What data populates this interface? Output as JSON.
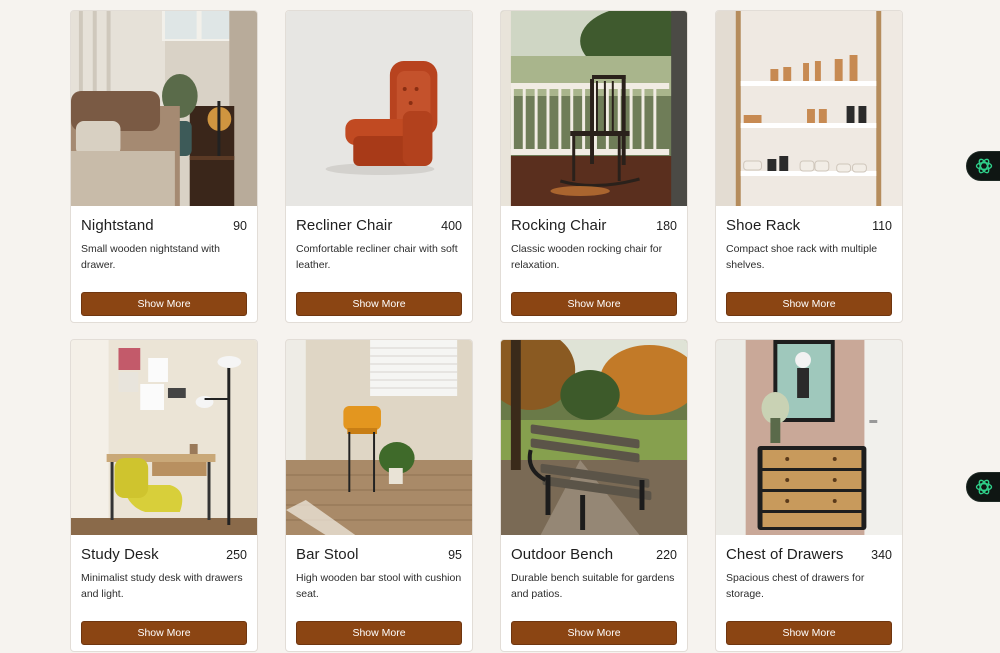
{
  "button_label": "Show More",
  "products": [
    {
      "title": "Nightstand",
      "price": "90",
      "description": "Small wooden nightstand with drawer.",
      "image": "bedroom-nightstand-lamp"
    },
    {
      "title": "Recliner Chair",
      "price": "400",
      "description": "Comfortable recliner chair with soft leather.",
      "image": "orange-recliner-chair"
    },
    {
      "title": "Rocking Chair",
      "price": "180",
      "description": "Classic wooden rocking chair for relaxation.",
      "image": "porch-rocking-chair"
    },
    {
      "title": "Shoe Rack",
      "price": "110",
      "description": "Compact shoe rack with multiple shelves.",
      "image": "shoe-shelves"
    },
    {
      "title": "Study Desk",
      "price": "250",
      "description": "Minimalist study desk with drawers and light.",
      "image": "desk-yellow-chair-lamp"
    },
    {
      "title": "Bar Stool",
      "price": "95",
      "description": "High wooden bar stool with cushion seat.",
      "image": "bar-stool-plant"
    },
    {
      "title": "Outdoor Bench",
      "price": "220",
      "description": "Durable bench suitable for gardens and patios.",
      "image": "park-bench-autumn"
    },
    {
      "title": "Chest of Drawers",
      "price": "340",
      "description": "Spacious chest of drawers for storage.",
      "image": "wooden-dresser-flowers"
    }
  ],
  "colors": {
    "accent": "#8b4513",
    "background": "#f6f3ef",
    "assistant_icon": "#2fd18a"
  },
  "side_widgets": [
    "assistant-icon",
    "assistant-icon"
  ]
}
